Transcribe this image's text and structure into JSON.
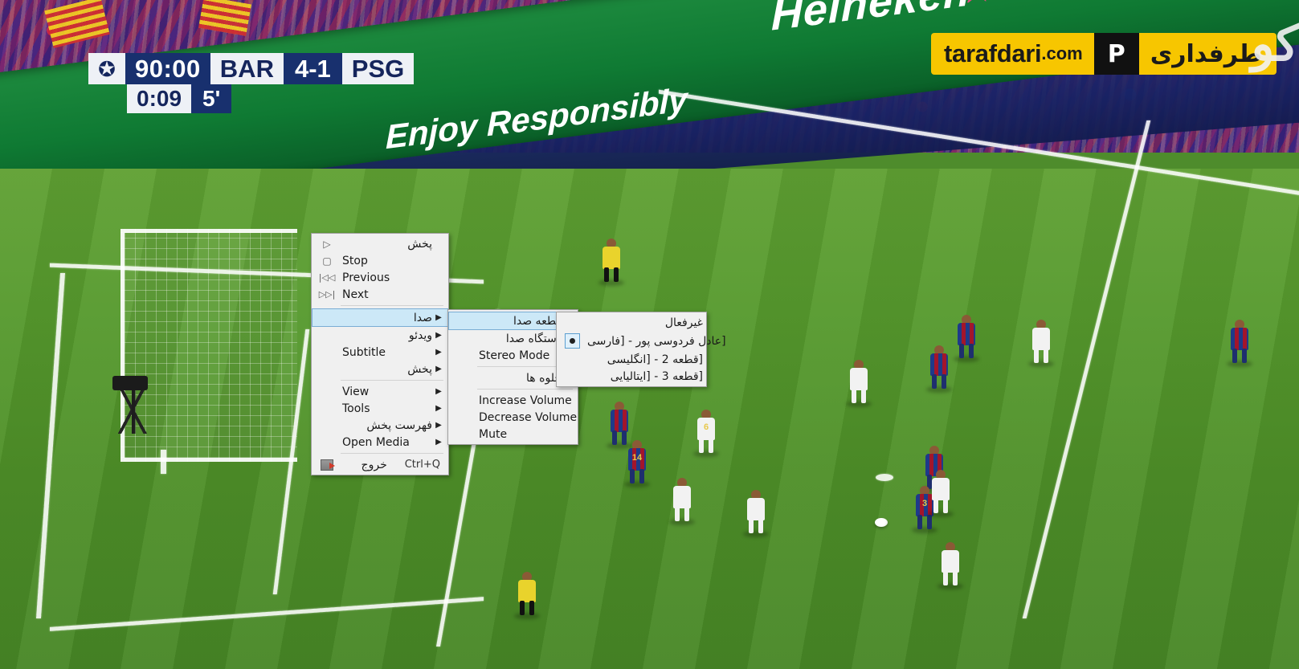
{
  "scoreboard": {
    "competition_icon": "uefa-champions-league-star-ball",
    "clock": "90:00",
    "home_team": "BAR",
    "score": "4-1",
    "away_team": "PSG",
    "added_clock": "0:09",
    "added_minutes": "5'"
  },
  "watermark": {
    "site_name": "tarafdari",
    "tld": ".com",
    "mark": "P",
    "persian_name": "طرفداری",
    "bg_color": "#f7c600",
    "mark_bg_color": "#111111"
  },
  "advertising": {
    "board_1": "Heineken",
    "board_2": "Enjoy Responsibly",
    "board_3": "Heineken",
    "board_color": "#0f7a33"
  },
  "context_menu": {
    "items": [
      {
        "icon": "play-icon",
        "label": "پخش",
        "rtl": true,
        "submenu": false,
        "shortcut": ""
      },
      {
        "icon": "stop-icon",
        "label": "Stop",
        "rtl": false,
        "submenu": false,
        "shortcut": ""
      },
      {
        "icon": "previous-icon",
        "label": "Previous",
        "rtl": false,
        "submenu": false,
        "shortcut": ""
      },
      {
        "icon": "next-icon",
        "label": "Next",
        "rtl": false,
        "submenu": false,
        "shortcut": ""
      },
      {
        "icon": "",
        "label": "صدا",
        "rtl": true,
        "submenu": true,
        "shortcut": "",
        "selected": true
      },
      {
        "icon": "",
        "label": "ویدئو",
        "rtl": true,
        "submenu": true,
        "shortcut": ""
      },
      {
        "icon": "",
        "label": "Subtitle",
        "rtl": false,
        "submenu": true,
        "shortcut": ""
      },
      {
        "icon": "",
        "label": "پخش",
        "rtl": true,
        "submenu": true,
        "shortcut": ""
      },
      {
        "icon": "",
        "label": "View",
        "rtl": false,
        "submenu": true,
        "shortcut": ""
      },
      {
        "icon": "",
        "label": "Tools",
        "rtl": false,
        "submenu": true,
        "shortcut": ""
      },
      {
        "icon": "",
        "label": "فهرست پخش",
        "rtl": true,
        "submenu": true,
        "shortcut": ""
      },
      {
        "icon": "",
        "label": "Open Media",
        "rtl": false,
        "submenu": true,
        "shortcut": ""
      },
      {
        "icon": "quit-icon",
        "label": "خروج",
        "rtl": true,
        "submenu": false,
        "shortcut": "Ctrl+Q"
      }
    ]
  },
  "audio_submenu": {
    "items": [
      {
        "label": "قطعه صدا",
        "rtl": true,
        "submenu": true,
        "selected": true
      },
      {
        "label": "دستگاه صدا",
        "rtl": true,
        "submenu": true,
        "selected": false
      },
      {
        "label": "Stereo Mode",
        "rtl": false,
        "submenu": true,
        "selected": false
      },
      {
        "label": "جلوه ها",
        "rtl": true,
        "submenu": true,
        "selected": false
      },
      {
        "label": "Increase Volume",
        "rtl": false,
        "submenu": false,
        "selected": false
      },
      {
        "label": "Decrease Volume",
        "rtl": false,
        "submenu": false,
        "selected": false
      },
      {
        "label": "Mute",
        "rtl": false,
        "submenu": false,
        "selected": false
      }
    ]
  },
  "audio_track_submenu": {
    "items": [
      {
        "label": "غیرفعال",
        "rtl": true,
        "checked": false
      },
      {
        "label": "[عادل فردوسی پور - [فارسی",
        "rtl": true,
        "checked": true
      },
      {
        "label": "[قطعه 2 - [انگلیسی",
        "rtl": true,
        "checked": false
      },
      {
        "label": "[قطعه 3 - [ایتالیایی",
        "rtl": true,
        "checked": false
      }
    ]
  },
  "theme": {
    "menu_bg": "#f0f0f0",
    "menu_border": "#a0a0a0",
    "highlight_bg": "#cce8f7",
    "highlight_border": "#7aadd4",
    "text_color": "#1a1a1a"
  }
}
